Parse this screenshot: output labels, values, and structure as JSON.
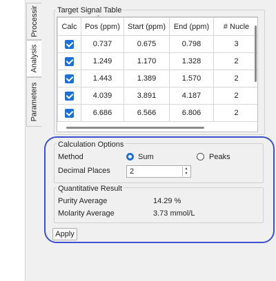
{
  "tabs": [
    {
      "label": "Processir",
      "active": false
    },
    {
      "label": "Analysis",
      "active": true
    },
    {
      "label": "Parameters",
      "active": false
    }
  ],
  "target_table": {
    "title": "Target Signal Table",
    "columns": [
      "Calc",
      "Pos (ppm)",
      "Start (ppm)",
      "End (ppm)",
      "# Nucle"
    ],
    "rows": [
      {
        "calc": true,
        "pos": "0.737",
        "start": "0.675",
        "end": "0.798",
        "nuclei": "3"
      },
      {
        "calc": true,
        "pos": "1.249",
        "start": "1.170",
        "end": "1.328",
        "nuclei": "2"
      },
      {
        "calc": true,
        "pos": "1.443",
        "start": "1.389",
        "end": "1.570",
        "nuclei": "2"
      },
      {
        "calc": true,
        "pos": "4.039",
        "start": "3.891",
        "end": "4.187",
        "nuclei": "2"
      },
      {
        "calc": true,
        "pos": "6.686",
        "start": "6.566",
        "end": "6.806",
        "nuclei": "2"
      }
    ]
  },
  "calc_options": {
    "title": "Calculation Options",
    "method_label": "Method",
    "method_options": [
      "Sum",
      "Peaks"
    ],
    "method_selected": "Sum",
    "decimal_label": "Decimal Places",
    "decimal_value": "2"
  },
  "quant_result": {
    "title": "Quantitative Result",
    "purity_label": "Purity Average",
    "purity_value": "14.29 %",
    "molarity_label": "Molarity Average",
    "molarity_value": "3.73 mmol/L"
  },
  "apply_label": "Apply",
  "colors": {
    "accent": "#1f6fd8",
    "highlight": "#3a4fcf"
  }
}
